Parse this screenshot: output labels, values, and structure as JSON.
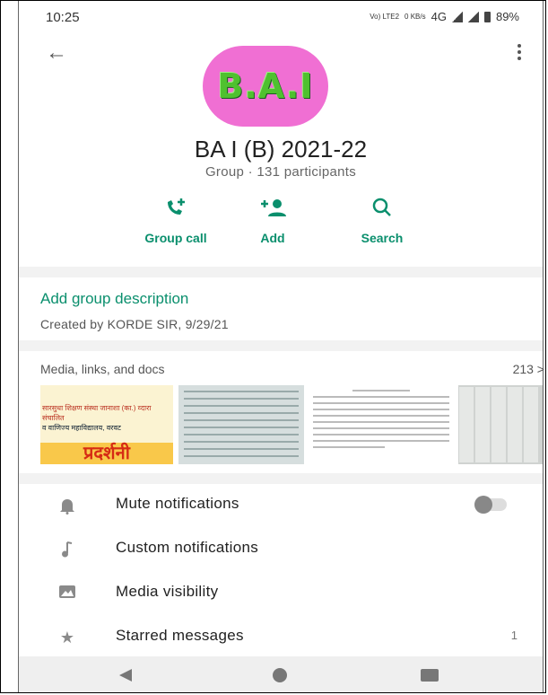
{
  "status_bar": {
    "time": "10:25",
    "volte": "Vo) LTE2",
    "net_speed": "0 KB/s",
    "network": "4G",
    "battery": "89%"
  },
  "header": {
    "back_icon": "arrow-left-icon",
    "menu_icon": "more-vert-icon"
  },
  "group": {
    "avatar_text": "B.A.I",
    "name": "BA I (B) 2021-22",
    "subtitle": "Group · 131 participants"
  },
  "actions": [
    {
      "label": "Group call",
      "icon": "add-call-icon"
    },
    {
      "label": "Add",
      "icon": "person-add-icon"
    },
    {
      "label": "Search",
      "icon": "search-icon"
    }
  ],
  "description": {
    "add_label": "Add group description",
    "created": "Created by KORDE SIR, 9/29/21"
  },
  "media": {
    "title": "Media, links, and docs",
    "count": "213 >",
    "thumb1_line1": "सारसुधा शिक्षण संस्था जानाशा (का.) व्दारा संचालित",
    "thumb1_line2": "व वाणिज्य महाविद्यालय, वरवट",
    "thumb1_big": "प्रदर्शनी"
  },
  "settings": [
    {
      "label": "Mute notifications",
      "icon": "bell-icon",
      "toggle": false
    },
    {
      "label": "Custom notifications",
      "icon": "music-note-icon"
    },
    {
      "label": "Media visibility",
      "icon": "image-icon"
    },
    {
      "label": "Starred messages",
      "icon": "star-icon",
      "value": "1"
    }
  ],
  "colors": {
    "accent": "#0a8f6d",
    "avatar_bg": "#f06fd3",
    "avatar_text": "#4fc12f"
  }
}
